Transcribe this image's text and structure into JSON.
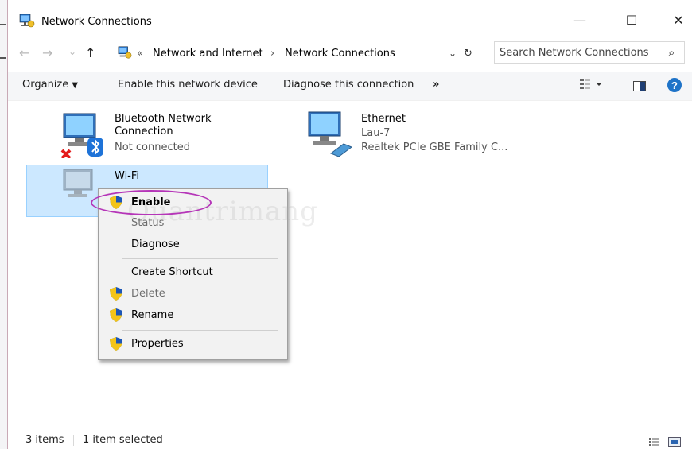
{
  "window": {
    "title": "Network Connections",
    "minimize": "—",
    "maximize": "☐",
    "close": "✕"
  },
  "nav": {
    "back": "←",
    "forward": "→",
    "recent": "⌄",
    "up": "↑",
    "chevron": "«",
    "sep": "›",
    "dropdown": "⌄",
    "refresh": "↻"
  },
  "address": {
    "crumbs": [
      "Network and Internet",
      "Network Connections"
    ]
  },
  "search": {
    "placeholder": "Search Network Connections",
    "icon": "⌕"
  },
  "commands": {
    "organize": "Organize",
    "enable": "Enable this network device",
    "diagnose": "Diagnose this connection",
    "more": "»"
  },
  "items": [
    {
      "name": "Bluetooth Network",
      "name2": "Connection",
      "status": "Not connected"
    },
    {
      "name": "Ethernet",
      "status": "Lau-7",
      "device": "Realtek PCIe GBE Family C..."
    },
    {
      "name": "Wi-Fi"
    }
  ],
  "context_menu": {
    "enable": "Enable",
    "status": "Status",
    "diagnose": "Diagnose",
    "create_shortcut": "Create Shortcut",
    "delete": "Delete",
    "rename": "Rename",
    "properties": "Properties"
  },
  "watermark": "Quantrimang",
  "statusbar": {
    "count": "3 items",
    "selected": "1 item selected"
  },
  "colors": {
    "selection": "#cce8ff",
    "highlight_ellipse": "#b535b8",
    "help": "#1e73c8"
  }
}
